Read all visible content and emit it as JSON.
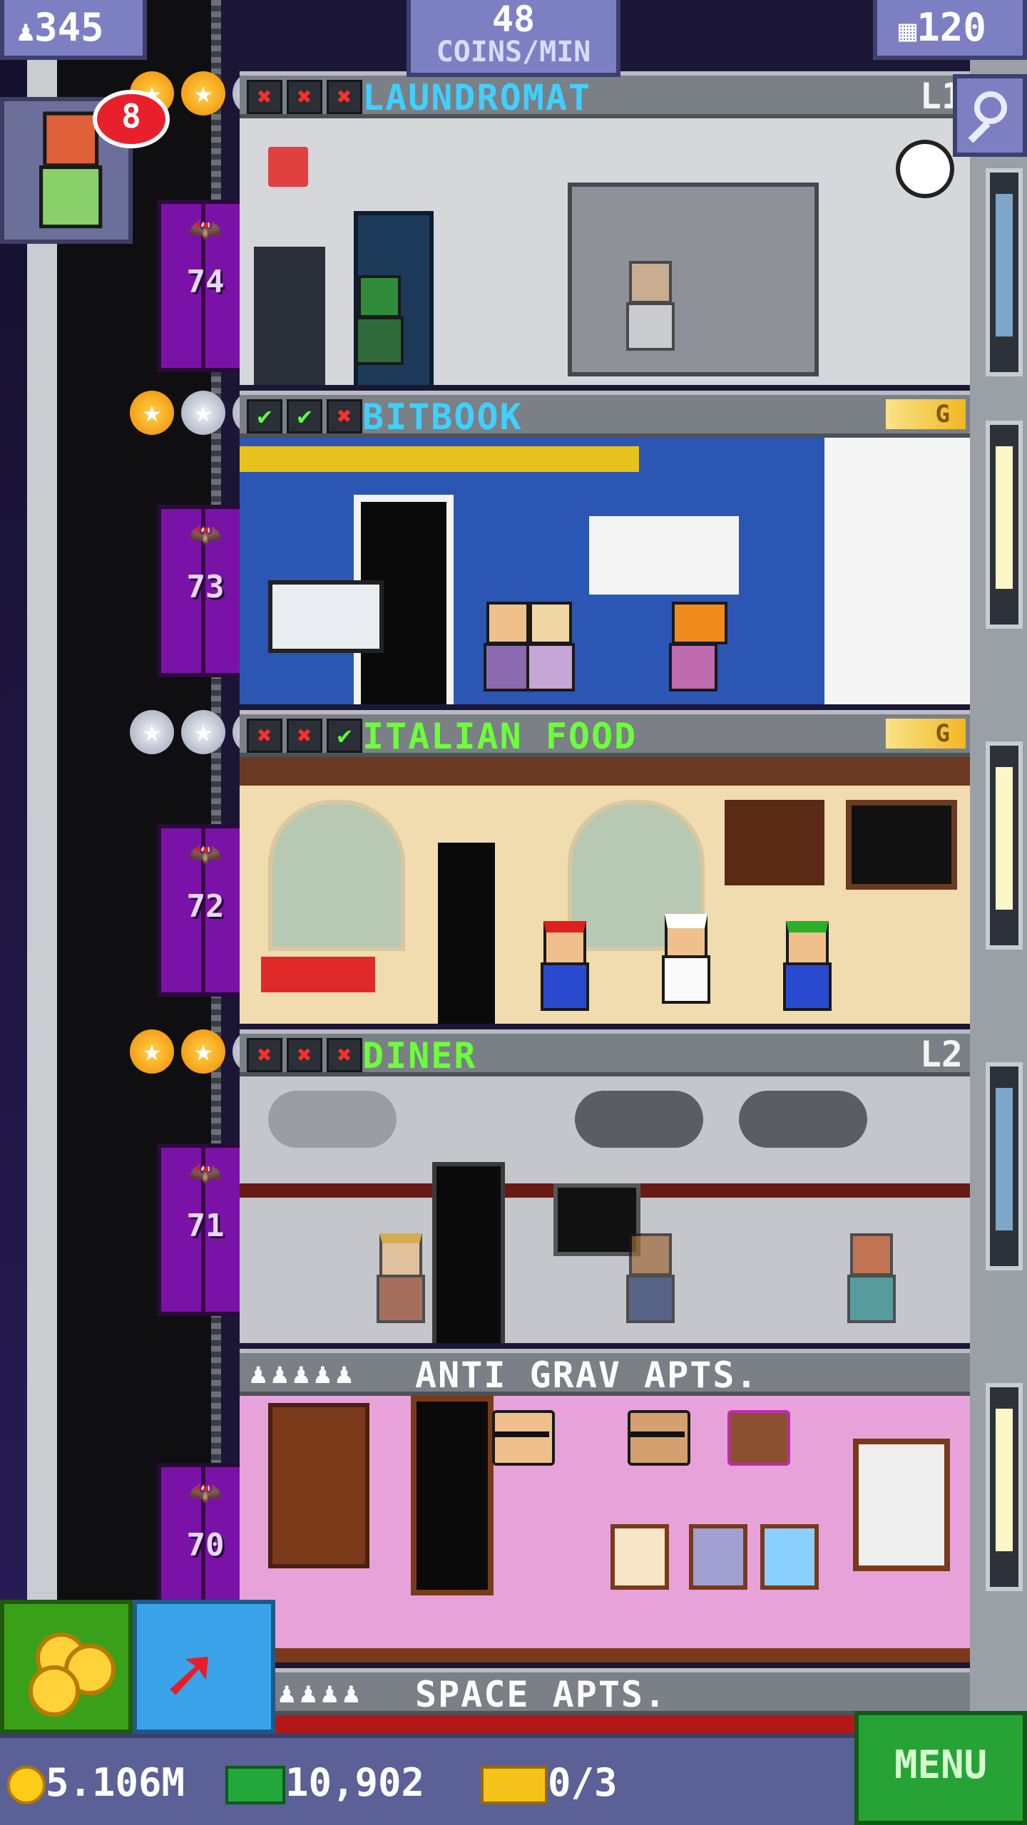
{
  "hud": {
    "population": "345",
    "coins_per_min_value": "48",
    "coins_per_min_label": "COINS/MIN",
    "floors_count": "120",
    "notification_count": "8"
  },
  "floors": [
    {
      "number": "74",
      "name": "LAUNDROMAT",
      "tag": "L1",
      "stars": [
        "gold",
        "gold",
        "silver"
      ],
      "stock": [
        "x",
        "x",
        "x"
      ],
      "name_color": "#3fd0ff"
    },
    {
      "number": "73",
      "name": "BITBOOK",
      "tag": "G",
      "stars": [
        "gold",
        "silver",
        "silver"
      ],
      "stock": [
        "v",
        "v",
        "x"
      ],
      "name_color": "#3fd0ff"
    },
    {
      "number": "72",
      "name": "ITALIAN FOOD",
      "tag": "G",
      "stars": [
        "silver",
        "silver",
        "silver"
      ],
      "stock": [
        "x",
        "x",
        "v"
      ],
      "name_color": "#6cff3a"
    },
    {
      "number": "71",
      "name": "DINER",
      "tag": "L2",
      "stars": [
        "gold",
        "gold",
        "silver"
      ],
      "stock": [
        "x",
        "x",
        "x"
      ],
      "name_color": "#6cff3a"
    },
    {
      "number": "70",
      "name": "ANTI GRAV APTS.",
      "tag": "",
      "stars": [],
      "stock": [],
      "name_color": "#ffffff"
    }
  ],
  "next_floor": {
    "name": "SPACE APTS."
  },
  "bottom": {
    "coins": "5.106M",
    "bux": "10,902",
    "tickets": "0/3",
    "menu_label": "MENU"
  },
  "colors": {
    "gold_star": "#f6a800",
    "silver_star": "#c6cbd8",
    "elevator": "#7a12a8",
    "menu": "#27a336"
  }
}
